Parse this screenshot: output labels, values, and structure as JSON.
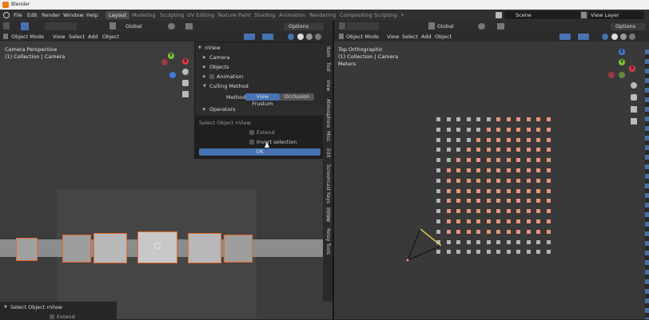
{
  "window": {
    "title": "Blender"
  },
  "menu": [
    "File",
    "Edit",
    "Render",
    "Window",
    "Help"
  ],
  "workspaces": [
    "Layout",
    "Modeling",
    "Sculpting",
    "UV Editing",
    "Texture Paint",
    "Shading",
    "Animation",
    "Rendering",
    "Compositing",
    "Scripting",
    "+"
  ],
  "scene": {
    "name": "Scene",
    "view_layer": "View Layer"
  },
  "left_header": {
    "mode": "Object Mode",
    "items": [
      "View",
      "Select",
      "Add",
      "Object"
    ],
    "transform": "Global",
    "options": "Options"
  },
  "left_viewport": {
    "title": "Camera Perspective",
    "collection": "(1) Collection | Camera"
  },
  "right_header": {
    "mode": "Object Mode",
    "items": [
      "View",
      "Select",
      "Add",
      "Object"
    ],
    "transform": "Global",
    "options": "Options"
  },
  "right_viewport": {
    "title": "Top Orthographic",
    "collection": "(1) Collection | Camera",
    "units": "Meters"
  },
  "gizmo": {
    "x": "X",
    "y": "Y",
    "z": "Z",
    "x_color": "#e0394a",
    "y_color": "#7ec23c",
    "z_color": "#3f7cd8"
  },
  "npanel": {
    "header": "nView",
    "sections": [
      "Camera",
      "Objects",
      "Animation",
      "Culling Method"
    ],
    "method_label": "Method",
    "methods": [
      "View Frustum",
      "Occlusion"
    ],
    "operators": "Operators",
    "select_label": "Select Object nView",
    "extend": "Extend",
    "invert": "Invert selection",
    "ok": "OK"
  },
  "side_tabs": [
    "Item",
    "Tool",
    "View",
    "Atmosphere",
    "Misc",
    "Edit",
    "Screencast Keys",
    "nView",
    "Relay Tools"
  ],
  "last_operator": {
    "title": "Select Object nView",
    "extend": "Extend"
  },
  "colors": {
    "accent": "#4772b3",
    "selected": "#e8967a",
    "unselected": "#b4b4b4",
    "active_outline": "#e87d0d"
  }
}
